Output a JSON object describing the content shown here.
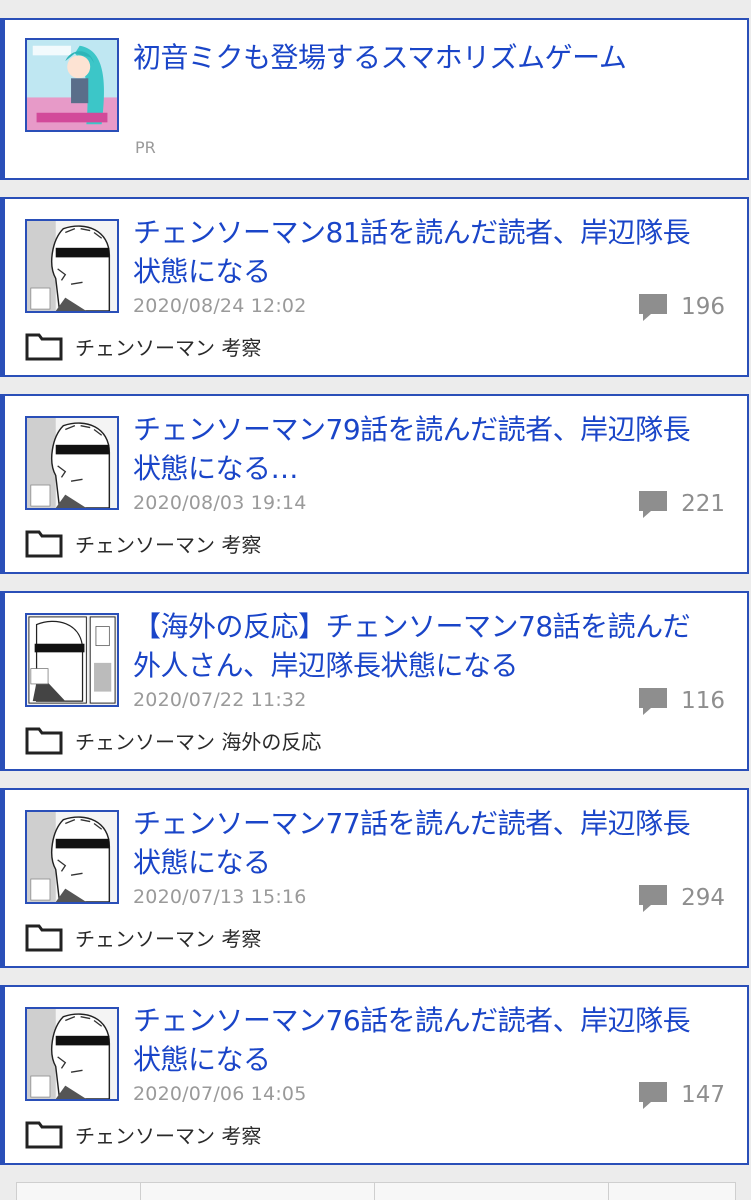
{
  "ad": {
    "title": "初音ミクも登場するスマホリズムゲーム",
    "label": "PR"
  },
  "articles": [
    {
      "title": "チェンソーマン81話を読んだ読者、岸辺隊長\n状態になる",
      "date": "2020/08/24 12:02",
      "comments": "196",
      "category": "チェンソーマン 考察"
    },
    {
      "title": "チェンソーマン79話を読んだ読者、岸辺隊長\n状態になる…",
      "date": "2020/08/03 19:14",
      "comments": "221",
      "category": "チェンソーマン 考察"
    },
    {
      "title": "【海外の反応】チェンソーマン78話を読んだ\n外人さん、岸辺隊長状態になる",
      "date": "2020/07/22 11:32",
      "comments": "116",
      "category": "チェンソーマン 海外の反応"
    },
    {
      "title": "チェンソーマン77話を読んだ読者、岸辺隊長\n状態になる",
      "date": "2020/07/13 15:16",
      "comments": "294",
      "category": "チェンソーマン 考察"
    },
    {
      "title": "チェンソーマン76話を読んだ読者、岸辺隊長\n状態になる",
      "date": "2020/07/06 14:05",
      "comments": "147",
      "category": "チェンソーマン 考察"
    }
  ],
  "icons": {
    "comment": "speech-bubble-icon",
    "category": "folder-icon"
  },
  "colors": {
    "accent": "#2a4fb8",
    "title": "#1a45c8",
    "meta": "#9a9a9a"
  }
}
